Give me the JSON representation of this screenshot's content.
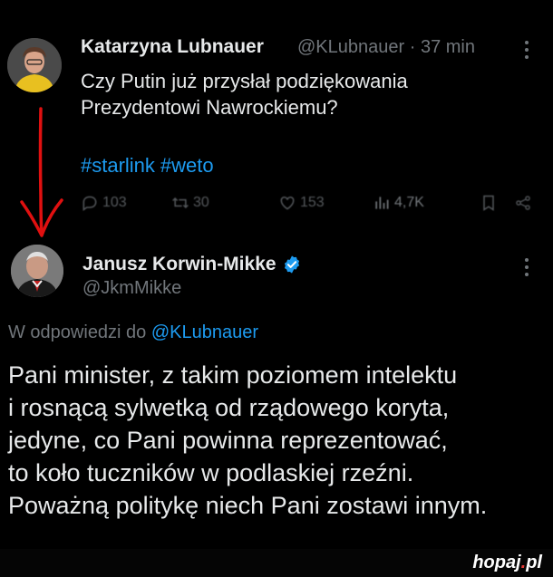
{
  "tweet1": {
    "author_name": "Katarzyna Lubnauer",
    "handle": "@KLubnauer",
    "separator": "·",
    "time": "37 min",
    "text_lines": [
      "Czy Putin już przysłał podziękowania",
      "Prezydentowi Nawrockiemu?"
    ],
    "hashtags": [
      "#starlink",
      "#weto"
    ],
    "actions": {
      "replies": "103",
      "retweets": "30",
      "likes": "153",
      "views": "4,7K"
    }
  },
  "tweet2": {
    "author_name": "Janusz Korwin-Mikke",
    "handle": "@JkmMikke",
    "replying_prefix": "W odpowiedzi do",
    "replying_to": "@KLubnauer",
    "text_lines": [
      "Pani minister, z takim poziomem intelektu",
      "i rosnącą sylwetką od rządowego koryta,",
      "jedyne, co Pani powinna reprezentować,",
      "to koło tuczników w podlaskiej rzeźni.",
      "Poważną politykę niech Pani zostawi innym."
    ]
  },
  "watermark": {
    "prefix": "hopaj",
    "dot": ".",
    "suffix": "pl"
  },
  "colors": {
    "background": "#000000",
    "text": "#e7e9ea",
    "muted": "#71767b",
    "accent": "#1d9bf0",
    "arrow": "#e01010"
  },
  "icons": [
    "reply-icon",
    "retweet-icon",
    "like-icon",
    "views-icon",
    "bookmark-icon",
    "share-icon",
    "more-icon",
    "verified-icon"
  ]
}
